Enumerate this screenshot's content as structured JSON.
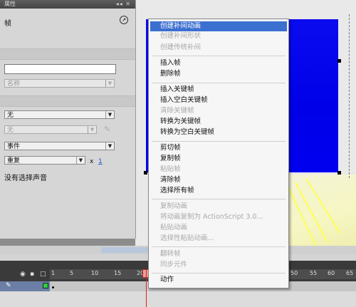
{
  "panel": {
    "title": "属性",
    "title_icons": "◂◂ ✕",
    "frame_label": "帧",
    "name_select": "名称",
    "sound_select": "无",
    "effect_select": "无",
    "sync_select": "事件",
    "repeat_select": "重复",
    "repeat_times": "1",
    "times_x": "x",
    "no_sound_text": "没有选择声音"
  },
  "timeline": {
    "ticks": [
      "1",
      "5",
      "10",
      "15",
      "20",
      "50",
      "55",
      "60",
      "65"
    ]
  },
  "menu": {
    "items": [
      {
        "label": "创建补间动画",
        "enabled": true,
        "hover": true
      },
      {
        "label": "创建补间形状",
        "enabled": false
      },
      {
        "label": "创建传统补间",
        "enabled": false
      },
      {
        "label": "插入帧",
        "enabled": true
      },
      {
        "label": "删除帧",
        "enabled": true
      },
      {
        "label": "插入关键帧",
        "enabled": true
      },
      {
        "label": "插入空白关键帧",
        "enabled": true
      },
      {
        "label": "清除关键帧",
        "enabled": false
      },
      {
        "label": "转换为关键帧",
        "enabled": true
      },
      {
        "label": "转换为空白关键帧",
        "enabled": true
      },
      {
        "label": "剪切帧",
        "enabled": true
      },
      {
        "label": "复制帧",
        "enabled": true
      },
      {
        "label": "粘贴帧",
        "enabled": false
      },
      {
        "label": "清除帧",
        "enabled": true
      },
      {
        "label": "选择所有帧",
        "enabled": true
      },
      {
        "label": "复制动画",
        "enabled": false
      },
      {
        "label": "将动画复制为 ActionScript 3.0...",
        "enabled": false
      },
      {
        "label": "粘贴动画",
        "enabled": false
      },
      {
        "label": "选择性粘贴动画...",
        "enabled": false
      },
      {
        "label": "翻转帧",
        "enabled": false
      },
      {
        "label": "同步元件",
        "enabled": false
      },
      {
        "label": "动作",
        "enabled": true
      }
    ]
  }
}
